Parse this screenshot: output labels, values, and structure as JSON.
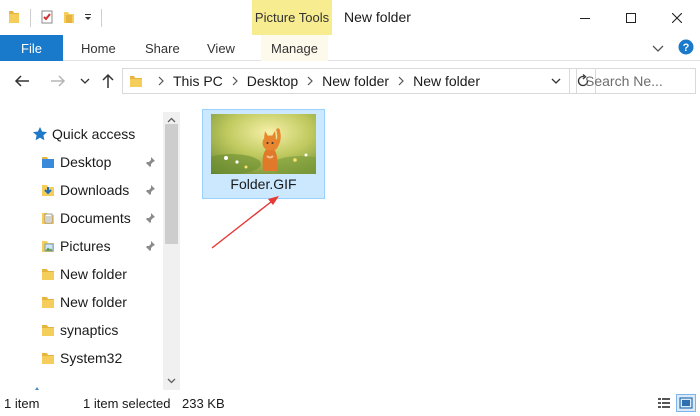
{
  "titlebar": {
    "context_tab": "Picture Tools",
    "window_title": "New folder",
    "quick_access_toolbar": [
      "folder-icon",
      "properties-icon",
      "new-folder-icon",
      "customize-dropdown-icon"
    ],
    "controls": [
      "minimize-icon",
      "maximize-icon",
      "close-icon"
    ]
  },
  "ribbon": {
    "tabs": [
      "File",
      "Home",
      "Share",
      "View",
      "Manage"
    ],
    "file_color": "#1979ca",
    "context_color": "#f7ec8f"
  },
  "addressbar": {
    "breadcrumbs": [
      "This PC",
      "Desktop",
      "New folder",
      "New folder"
    ],
    "search_placeholder": "Search Ne..."
  },
  "navpane": {
    "quick_access_label": "Quick access",
    "items": [
      {
        "label": "Desktop",
        "icon": "desktop-folder-icon",
        "pinned": true
      },
      {
        "label": "Downloads",
        "icon": "downloads-folder-icon",
        "pinned": true
      },
      {
        "label": "Documents",
        "icon": "documents-folder-icon",
        "pinned": true
      },
      {
        "label": "Pictures",
        "icon": "pictures-folder-icon",
        "pinned": true
      },
      {
        "label": "New folder",
        "icon": "folder-icon",
        "pinned": false
      },
      {
        "label": "New folder",
        "icon": "folder-icon",
        "pinned": false
      },
      {
        "label": "synaptics",
        "icon": "folder-icon",
        "pinned": false
      },
      {
        "label": "System32",
        "icon": "folder-icon",
        "pinned": false
      }
    ]
  },
  "content": {
    "files": [
      {
        "name": "Folder.GIF",
        "thumbnail": "kitten-photo",
        "selected": true
      }
    ],
    "selection_color": "#cce8ff",
    "annotation": "red-arrow"
  },
  "statusbar": {
    "item_count": "1 item",
    "selected": "1 item selected",
    "size": "233 KB"
  }
}
